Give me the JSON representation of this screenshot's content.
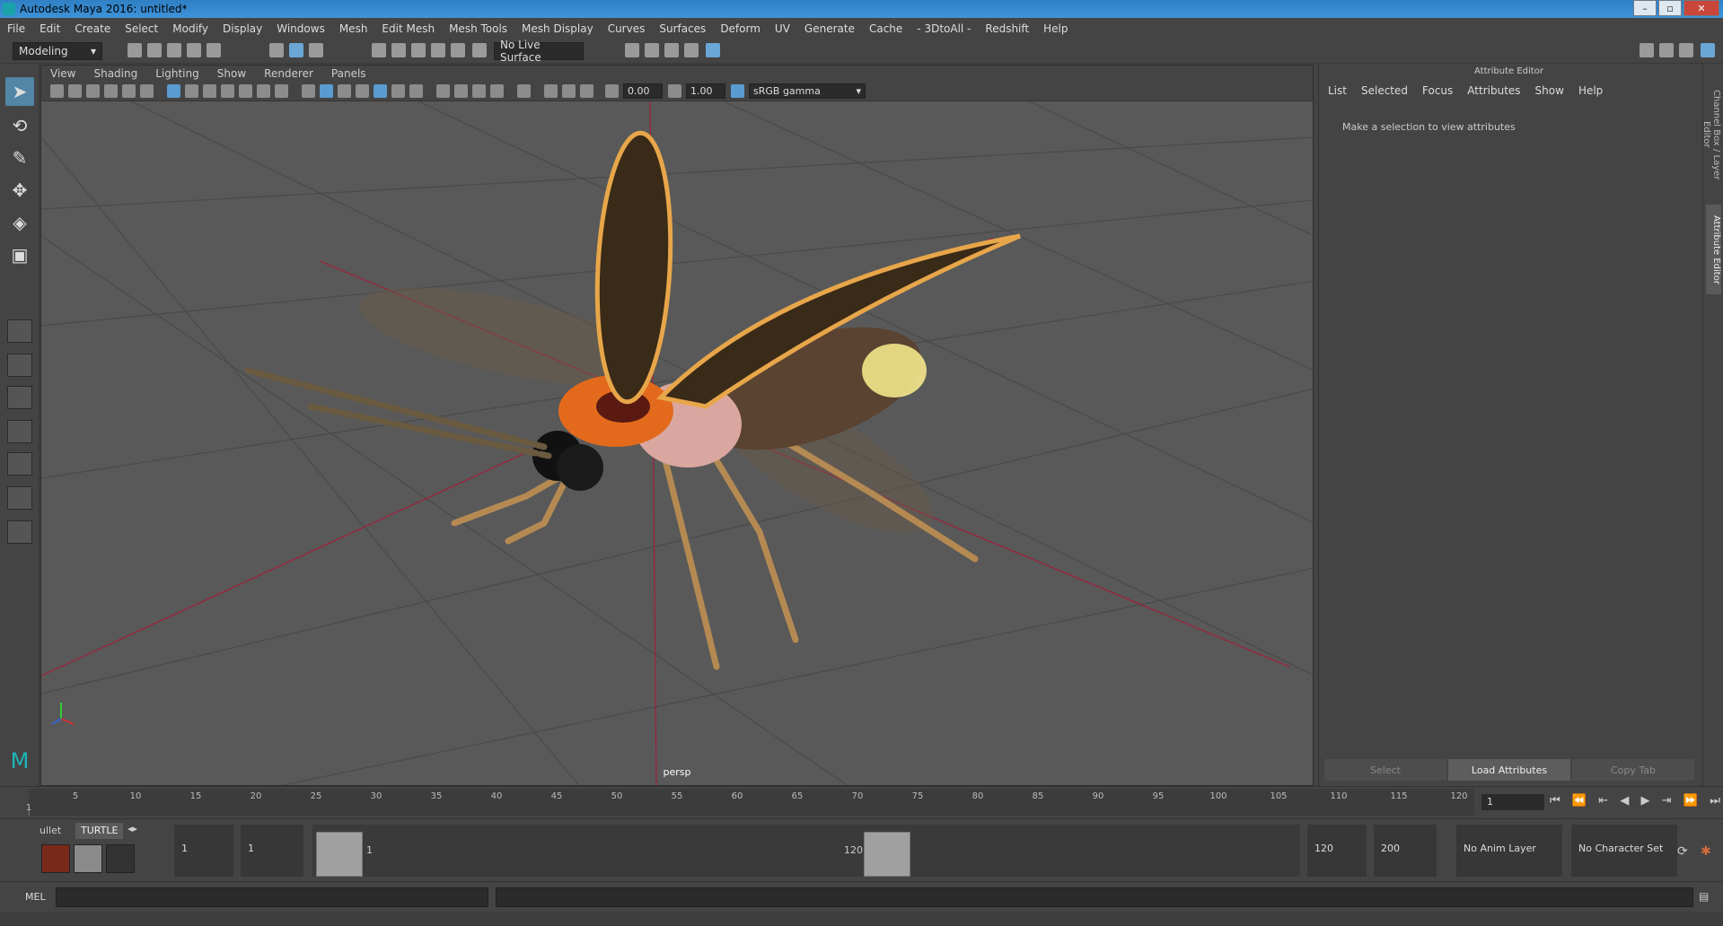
{
  "window": {
    "title": "Autodesk Maya 2016: untitled*"
  },
  "menu": [
    "File",
    "Edit",
    "Create",
    "Select",
    "Modify",
    "Display",
    "Windows",
    "Mesh",
    "Edit Mesh",
    "Mesh Tools",
    "Mesh Display",
    "Curves",
    "Surfaces",
    "Deform",
    "UV",
    "Generate",
    "Cache",
    "- 3DtoAll -",
    "Redshift",
    "Help"
  ],
  "toolbar": {
    "mode": "Modeling",
    "live_surface": "No Live Surface"
  },
  "viewport": {
    "menu": [
      "View",
      "Shading",
      "Lighting",
      "Show",
      "Renderer",
      "Panels"
    ],
    "exposure": "0.00",
    "gamma": "1.00",
    "color_space": "sRGB gamma",
    "camera_label": "persp"
  },
  "attribute_editor": {
    "title": "Attribute Editor",
    "tabs": [
      "List",
      "Selected",
      "Focus",
      "Attributes",
      "Show",
      "Help"
    ],
    "message": "Make a selection to view attributes",
    "buttons": {
      "select": "Select",
      "load": "Load Attributes",
      "copy": "Copy Tab"
    }
  },
  "side_tabs": [
    "Channel Box / Layer Editor",
    "Attribute Editor"
  ],
  "timeline": {
    "ticks": [
      "1",
      "5",
      "10",
      "15",
      "20",
      "25",
      "30",
      "35",
      "40",
      "45",
      "50",
      "55",
      "60",
      "65",
      "70",
      "75",
      "80",
      "85",
      "90",
      "95",
      "100",
      "105",
      "110",
      "115",
      "120"
    ],
    "current_frame": "1"
  },
  "range": {
    "shelf_tabs": [
      "ullet",
      "TURTLE"
    ],
    "start": "1",
    "playback_start": "1",
    "slider_start": "1",
    "slider_end": "120",
    "playback_end": "120",
    "end": "200",
    "anim_layer": "No Anim Layer",
    "character_set": "No Character Set"
  },
  "command_line": {
    "label": "MEL"
  }
}
